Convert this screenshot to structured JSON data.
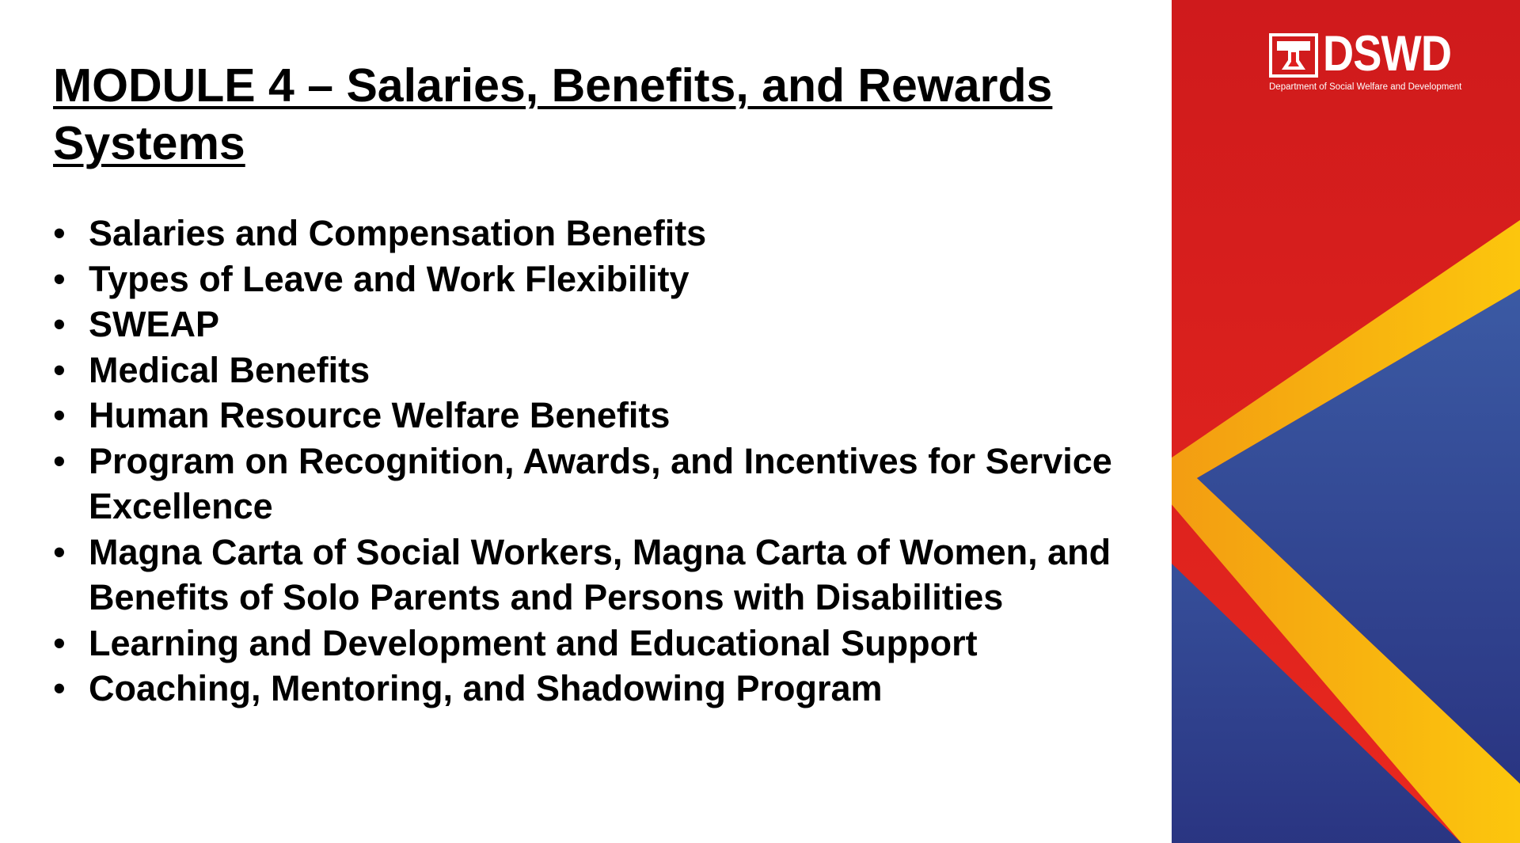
{
  "slide": {
    "title": "MODULE 4 – Salaries, Benefits, and Rewards Systems",
    "bullet_char": "•",
    "bullets": [
      "Salaries and Compensation Benefits",
      "Types of Leave and Work Flexibility",
      "SWEAP",
      "Medical Benefits",
      "Human Resource Welfare Benefits",
      "Program on Recognition, Awards, and Incentives for Service Excellence",
      "Magna Carta of Social Workers, Magna Carta of Women, and Benefits of Solo Parents and Persons with Disabilities",
      "Learning and Development and Educational Support",
      "Coaching, Mentoring, and Shadowing Program"
    ]
  },
  "logo": {
    "wordmark": "DSWD",
    "subtitle": "Department of Social Welfare and Development"
  },
  "colors": {
    "panel_red": "#E0201F",
    "panel_blue": "#2C3A8A",
    "stripe_yellow": "#F6B20F",
    "text": "#000000"
  }
}
